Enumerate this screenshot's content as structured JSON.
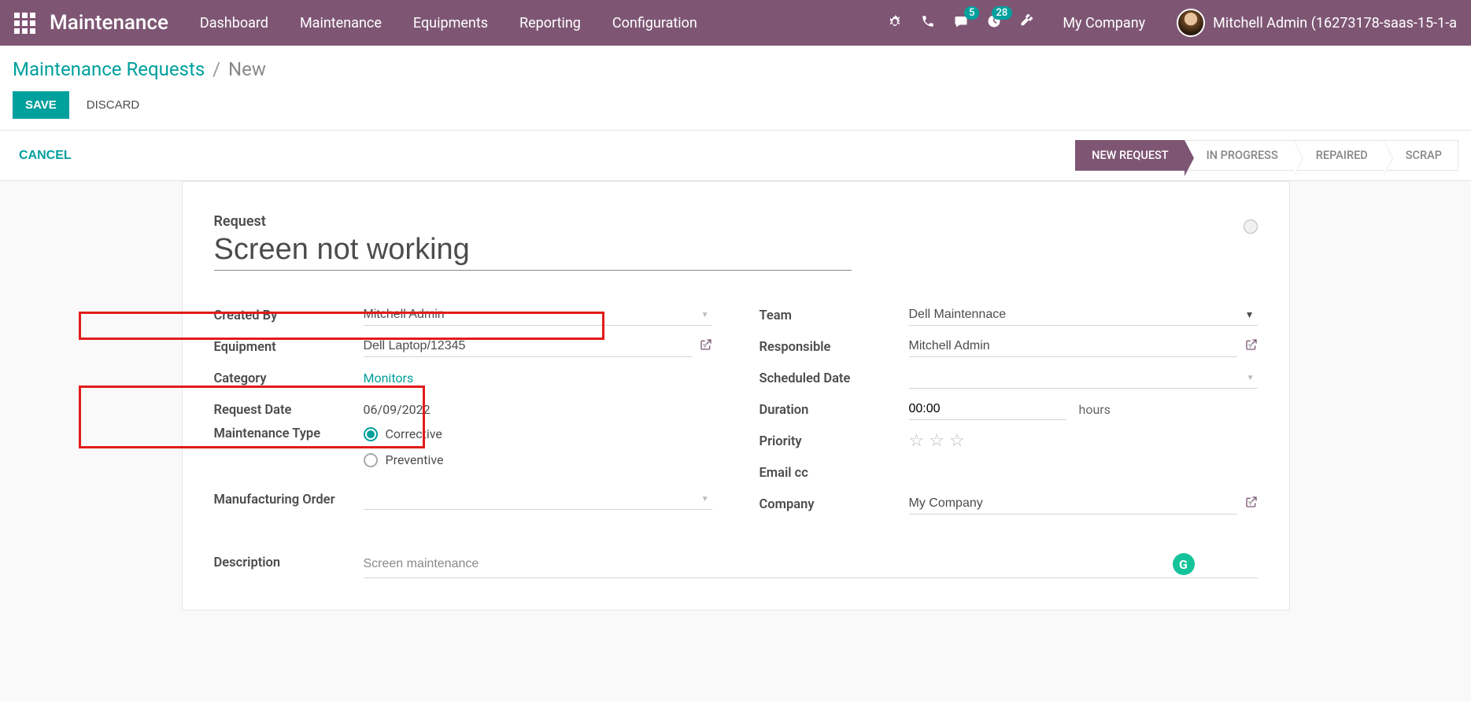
{
  "navbar": {
    "brand": "Maintenance",
    "menu": [
      "Dashboard",
      "Maintenance",
      "Equipments",
      "Reporting",
      "Configuration"
    ],
    "badges": {
      "messages": "5",
      "activities": "28"
    },
    "company": "My Company",
    "user": "Mitchell Admin (16273178-saas-15-1-a"
  },
  "breadcrumb": {
    "parent": "Maintenance Requests",
    "current": "New"
  },
  "buttons": {
    "save": "SAVE",
    "discard": "DISCARD",
    "cancel": "CANCEL"
  },
  "statusbar": [
    "NEW REQUEST",
    "IN PROGRESS",
    "REPAIRED",
    "SCRAP"
  ],
  "form": {
    "request_label": "Request",
    "title": "Screen not working",
    "left": {
      "created_by_label": "Created By",
      "created_by": "Mitchell Admin",
      "equipment_label": "Equipment",
      "equipment": "Dell Laptop/12345",
      "category_label": "Category",
      "category": "Monitors",
      "request_date_label": "Request Date",
      "request_date": "06/09/2022",
      "maintenance_type_label": "Maintenance Type",
      "mtype_corrective": "Corrective",
      "mtype_preventive": "Preventive",
      "mo_label": "Manufacturing Order",
      "mo": ""
    },
    "right": {
      "team_label": "Team",
      "team": "Dell Maintennace",
      "responsible_label": "Responsible",
      "responsible": "Mitchell Admin",
      "scheduled_date_label": "Scheduled Date",
      "scheduled_date": "",
      "duration_label": "Duration",
      "duration": "00:00",
      "hours": "hours",
      "priority_label": "Priority",
      "email_cc_label": "Email cc",
      "company_label": "Company",
      "company": "My Company"
    },
    "description_label": "Description",
    "description": "Screen maintenance"
  }
}
